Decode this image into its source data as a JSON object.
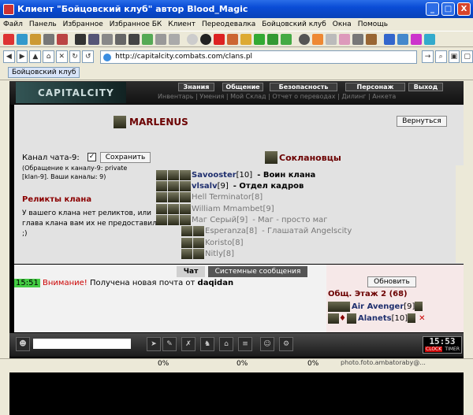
{
  "window": {
    "title": "Клиент \"Бойцовский клуб\" автор Blood_Magic",
    "minimize": "_",
    "maximize": "□",
    "close": "X"
  },
  "menu": [
    "Файл",
    "Панель",
    "Избранное",
    "Избранное БК",
    "Клиент",
    "Переодевалка",
    "Бойцовский клуб",
    "Окна",
    "Помощь"
  ],
  "address": {
    "url": "http://capitalcity.combats.com/clans.pl"
  },
  "doc_tab": "Бойцовский клуб",
  "game": {
    "logo": "CAPITALCITY",
    "nav": [
      "Знания",
      "Общение",
      "Безопасность",
      "Персонаж",
      "Выход"
    ],
    "subnav": "Инвентарь | Умения | Мой Склад | Отчет о переводах | Дилинг | Анкета",
    "player": "MARLENUS",
    "back_label": "Вернуться",
    "chat_channel_label": "Канал чата-9:",
    "chat_checked": "✓",
    "save_label": "Сохранить",
    "channel_hint1": "(Обращение к каналу-9: private",
    "channel_hint2": "[klan-9]. Ваши каналы: 9)",
    "relics_title": "Реликты клана",
    "relics_text": "У вашего клана нет реликтов, или глава клана вам их не предоставил ;)",
    "clanmates_title": "Соклановцы",
    "members": [
      {
        "name": "Savooster",
        "level": "[10]",
        "role": "- Воин клана",
        "grey": false
      },
      {
        "name": "vlsalv",
        "level": "[9]",
        "role": "- Отдел кадров",
        "grey": false
      },
      {
        "name": "Hell Terminator",
        "level": "[8]",
        "role": "",
        "grey": true
      },
      {
        "name": "William Mmambet",
        "level": "[9]",
        "role": "",
        "grey": true
      },
      {
        "name": "Маг Серый",
        "level": "[9]",
        "role": "- Маг - просто маг",
        "grey": true
      },
      {
        "name": "Esperanza",
        "level": "[8]",
        "role": "- Глашатай Angelscity",
        "grey": true
      },
      {
        "name": "Koristo",
        "level": "[8]",
        "role": "",
        "grey": true
      },
      {
        "name": "Nitly",
        "level": "[8]",
        "role": "",
        "grey": true
      }
    ]
  },
  "chat": {
    "tabs": [
      "Чат",
      "Системные сообщения"
    ],
    "message": {
      "time": "15:51",
      "prefix": "Внимание!",
      "text": "Получена новая почта от",
      "from": "daqidan"
    }
  },
  "online": {
    "refresh_label": "Обновить",
    "floor": "Общ. Этаж 2 (68)",
    "users": [
      {
        "name": "Air Avenger",
        "level": "[9]"
      },
      {
        "name": "Alanets",
        "level": "[10]"
      }
    ]
  },
  "clock": {
    "time": "15:53",
    "label_left": "CLOCK",
    "label_right": "TIMER"
  },
  "status": {
    "pcts": [
      "0%",
      "0%",
      "0%"
    ],
    "watermark": "photo.foto.ambatoraby@..."
  }
}
